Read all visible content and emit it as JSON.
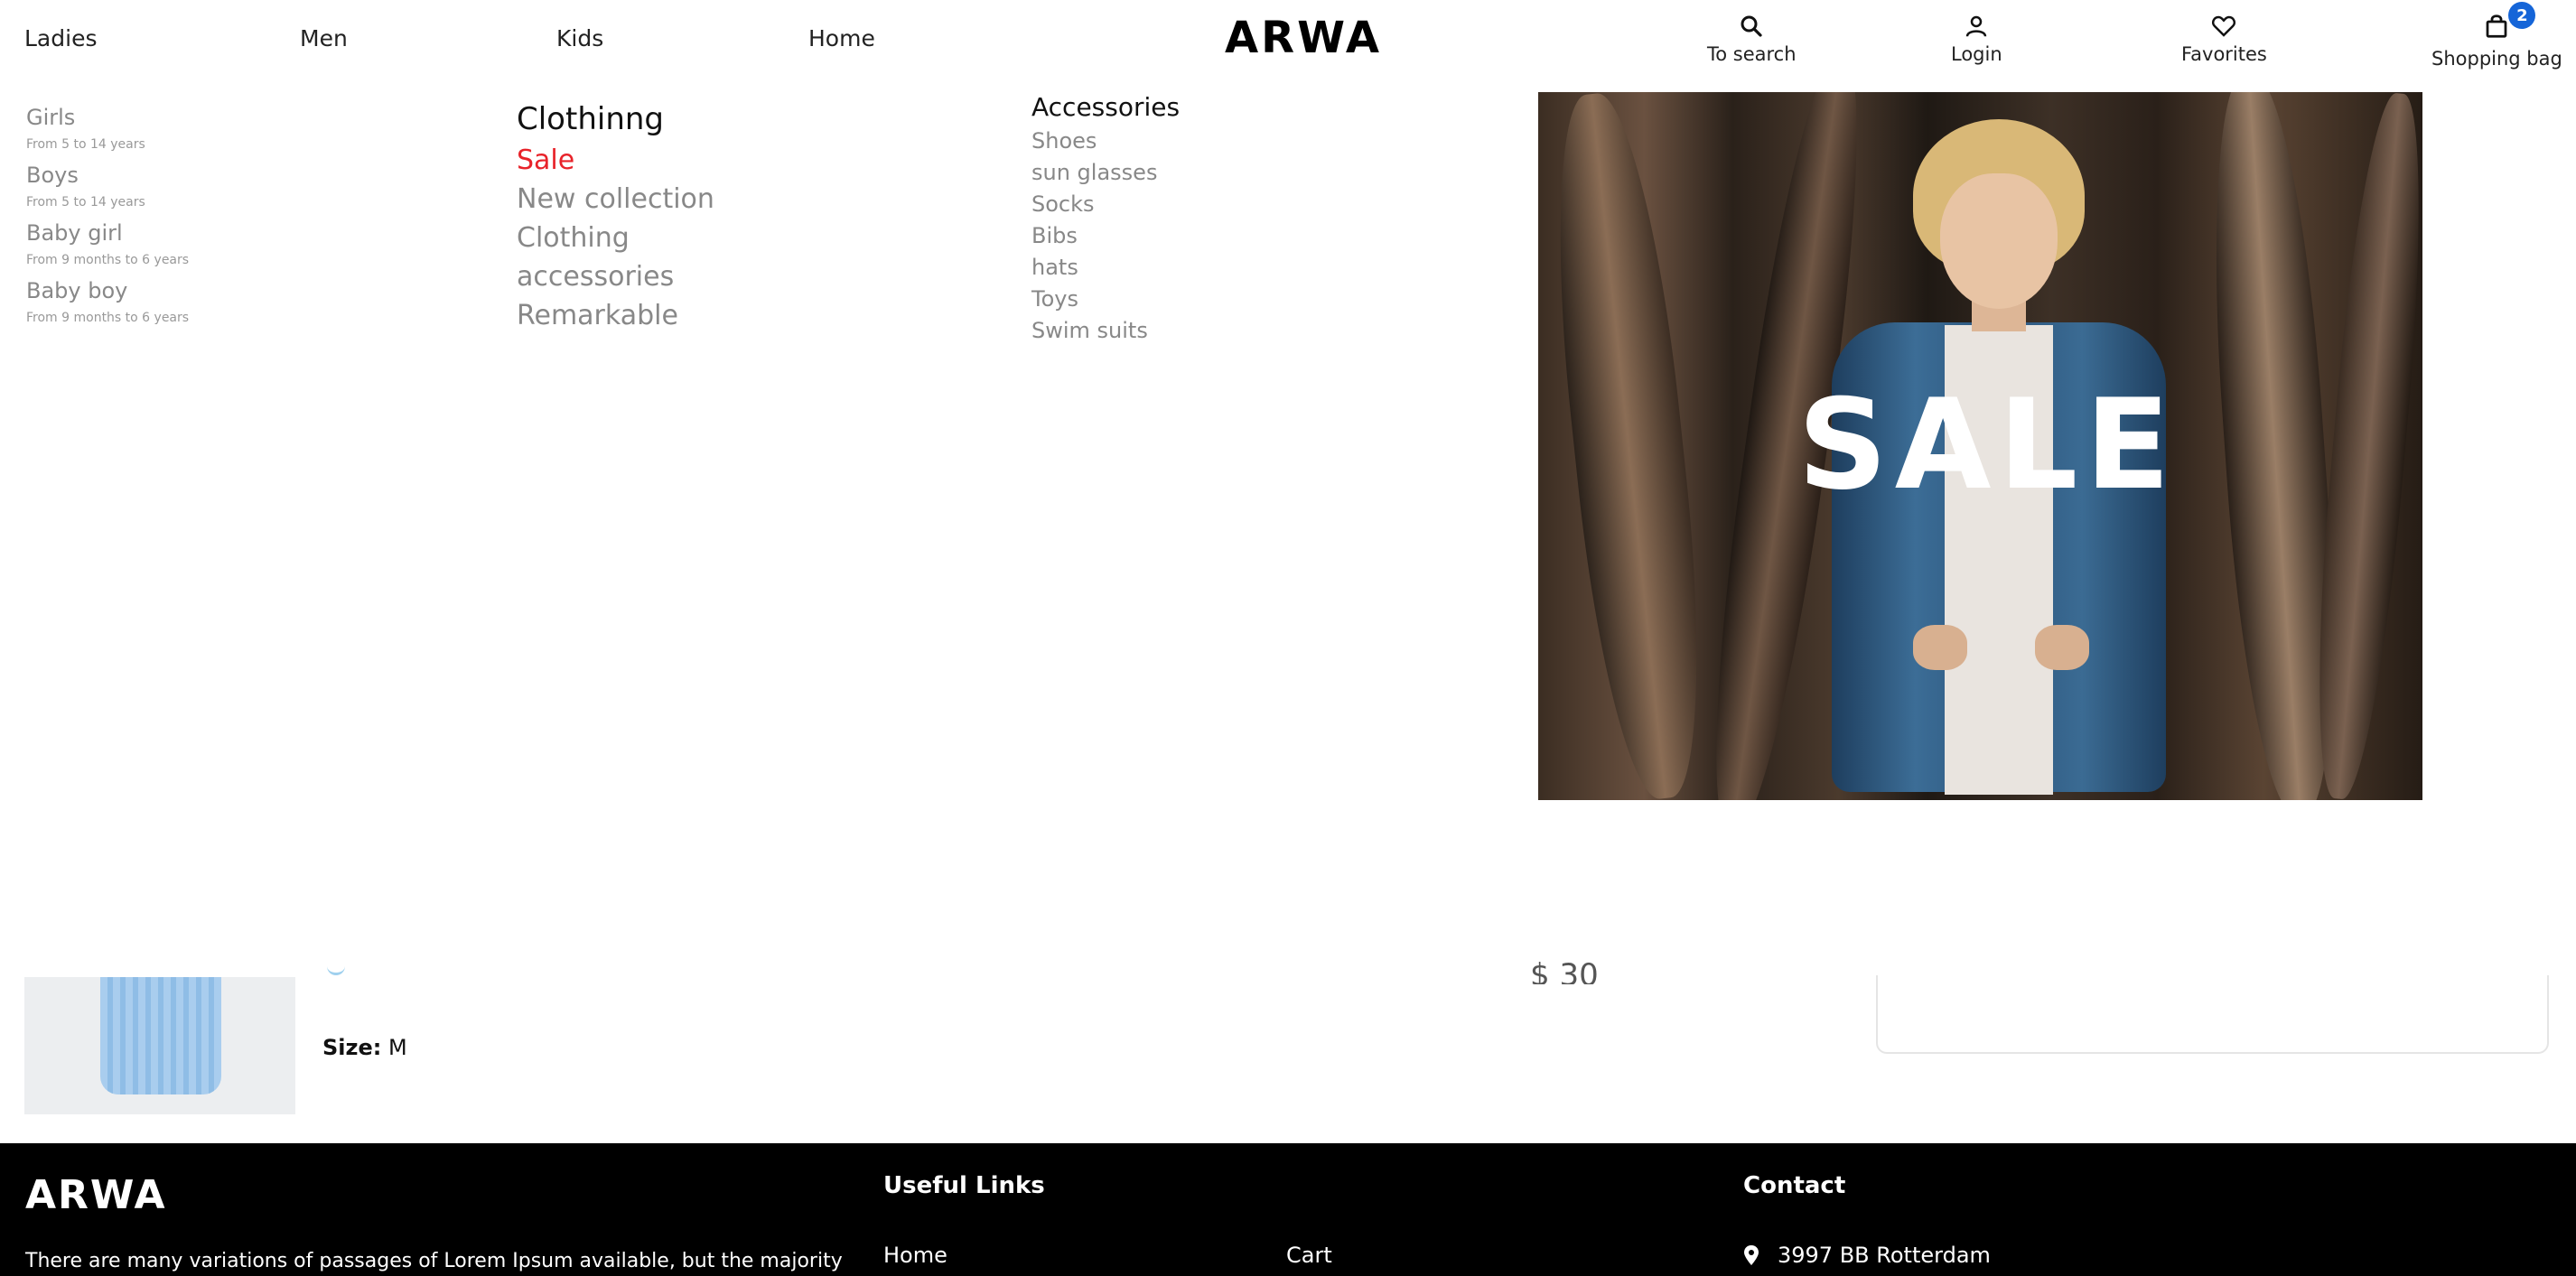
{
  "header": {
    "nav": [
      "Ladies",
      "Men",
      "Kids",
      "Home"
    ],
    "logo": "ARWA",
    "actions": {
      "search": "To search",
      "login": "Login",
      "favorites": "Favorites",
      "bag": "Shopping bag",
      "bag_count": "2"
    }
  },
  "mega_menu": {
    "categories": [
      {
        "label": "Girls",
        "sub": "From 5 to 14 years"
      },
      {
        "label": "Boys",
        "sub": "From 5 to 14 years"
      },
      {
        "label": "Baby girl",
        "sub": "From 9 months to 6 years"
      },
      {
        "label": "Baby boy",
        "sub": "From 9 months to 6 years"
      }
    ],
    "clothing": {
      "heading": "Clothinng",
      "items": [
        "Sale",
        "New collection",
        "Clothing",
        "accessories",
        "Remarkable"
      ]
    },
    "accessories": {
      "heading": "Accessories",
      "items": [
        "Shoes",
        "sun glasses",
        "Socks",
        "Bibs",
        "hats",
        "Toys",
        "Swim suits"
      ]
    },
    "promo": {
      "text": "SALE"
    }
  },
  "product": {
    "size_label": "Size:",
    "size_value": "M",
    "price_fragment": "$ 30"
  },
  "footer": {
    "logo": "ARWA",
    "about": "There are many variations of passages of Lorem Ipsum available, but the majority",
    "useful_links_heading": "Useful Links",
    "links": [
      "Home",
      "Cart"
    ],
    "contact_heading": "Contact",
    "address": "3997 BB Rotterdam"
  },
  "colors": {
    "sale": "#e8232a",
    "badge": "#1565d8",
    "footer_bg": "#000000"
  }
}
